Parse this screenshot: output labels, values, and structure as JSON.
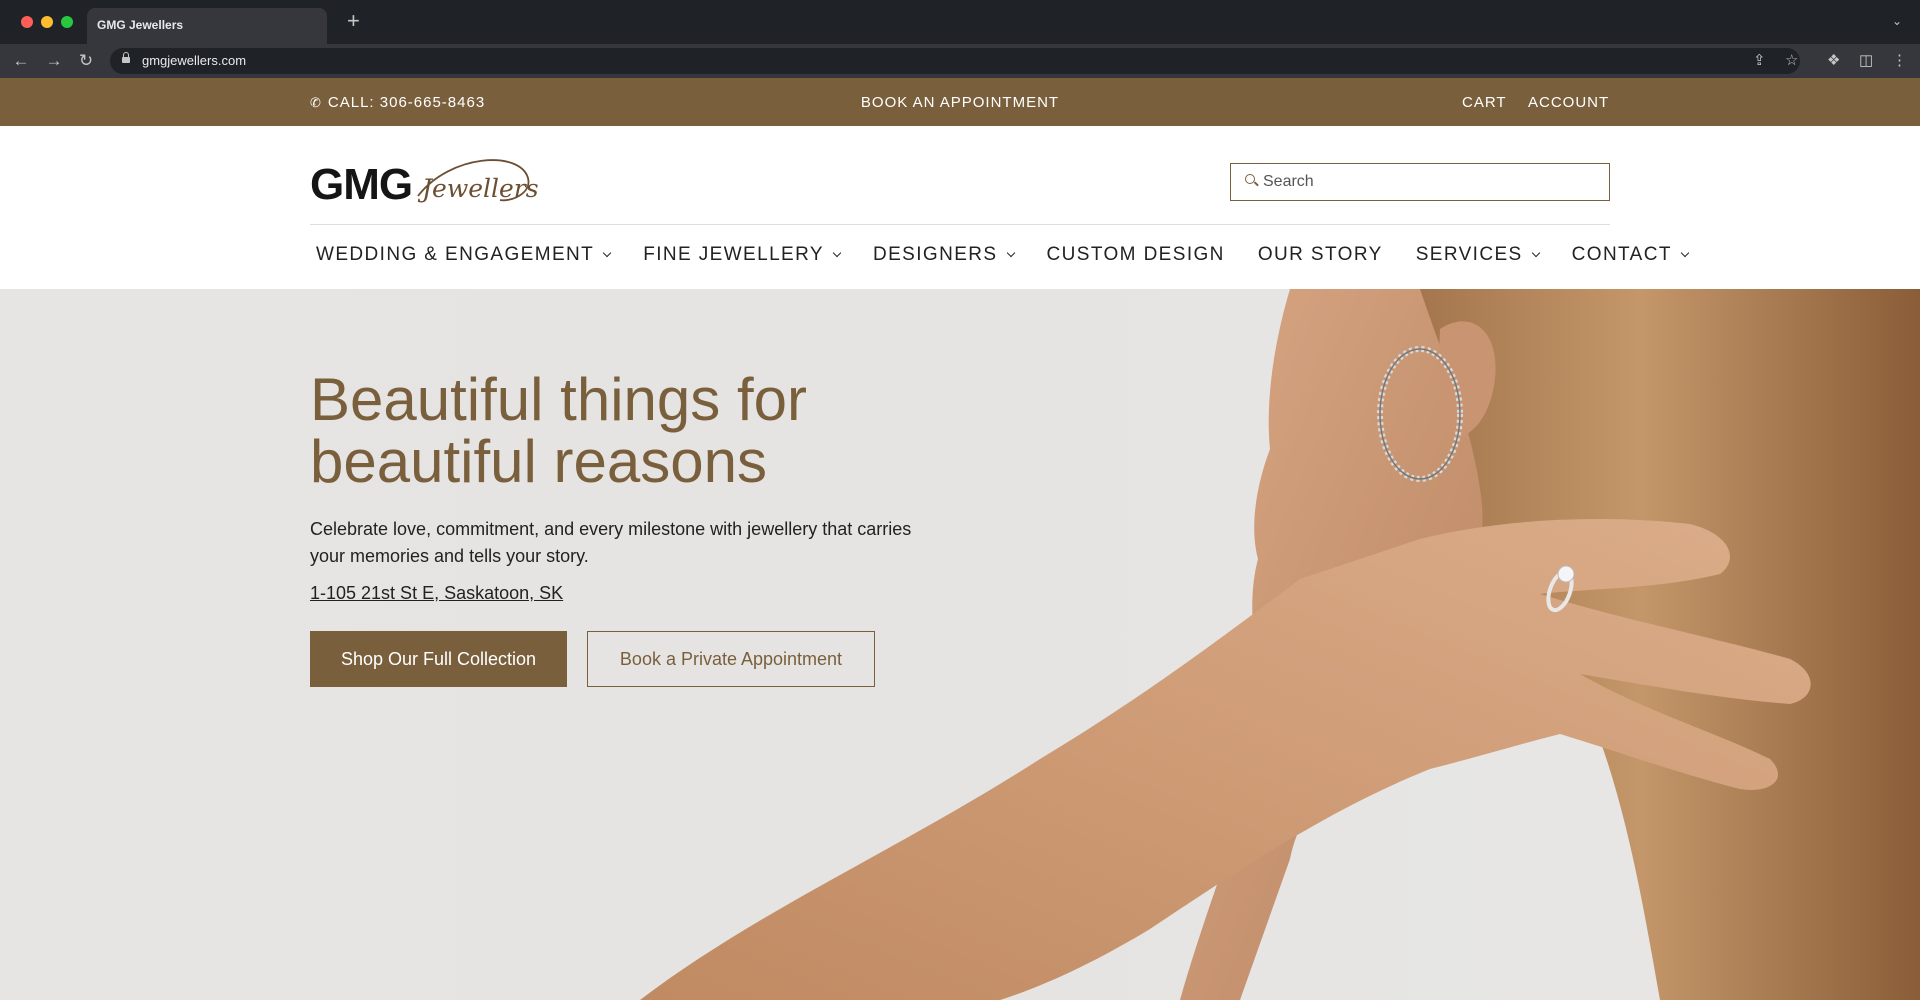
{
  "browser": {
    "tab_title": "GMG Jewellers",
    "url": "gmgjewellers.com"
  },
  "topbar": {
    "call": "CALL: 306-665-8463",
    "book": "BOOK AN APPOINTMENT",
    "cart": "CART",
    "account": "ACCOUNT"
  },
  "header": {
    "logo_main": "GMG",
    "logo_script": "Jewellers",
    "search_placeholder": "Search",
    "nav": [
      {
        "label": "WEDDING & ENGAGEMENT",
        "dropdown": true
      },
      {
        "label": "FINE JEWELLERY",
        "dropdown": true
      },
      {
        "label": "DESIGNERS",
        "dropdown": true
      },
      {
        "label": "CUSTOM DESIGN",
        "dropdown": false
      },
      {
        "label": "OUR STORY",
        "dropdown": false
      },
      {
        "label": "SERVICES",
        "dropdown": true
      },
      {
        "label": "CONTACT",
        "dropdown": true
      }
    ]
  },
  "hero": {
    "title_line1": "Beautiful things for",
    "title_line2": "beautiful reasons",
    "subtitle": "Celebrate love, commitment, and every milestone with jewellery that carries your memories and tells your story.",
    "address": "1-105 21st St E, Saskatoon, SK",
    "primary_cta": "Shop Our Full Collection",
    "secondary_cta": "Book a Private Appointment"
  },
  "colors": {
    "brand": "#7a5f3d",
    "chrome_dark": "#1f2226",
    "chrome_bar": "#35373c"
  }
}
